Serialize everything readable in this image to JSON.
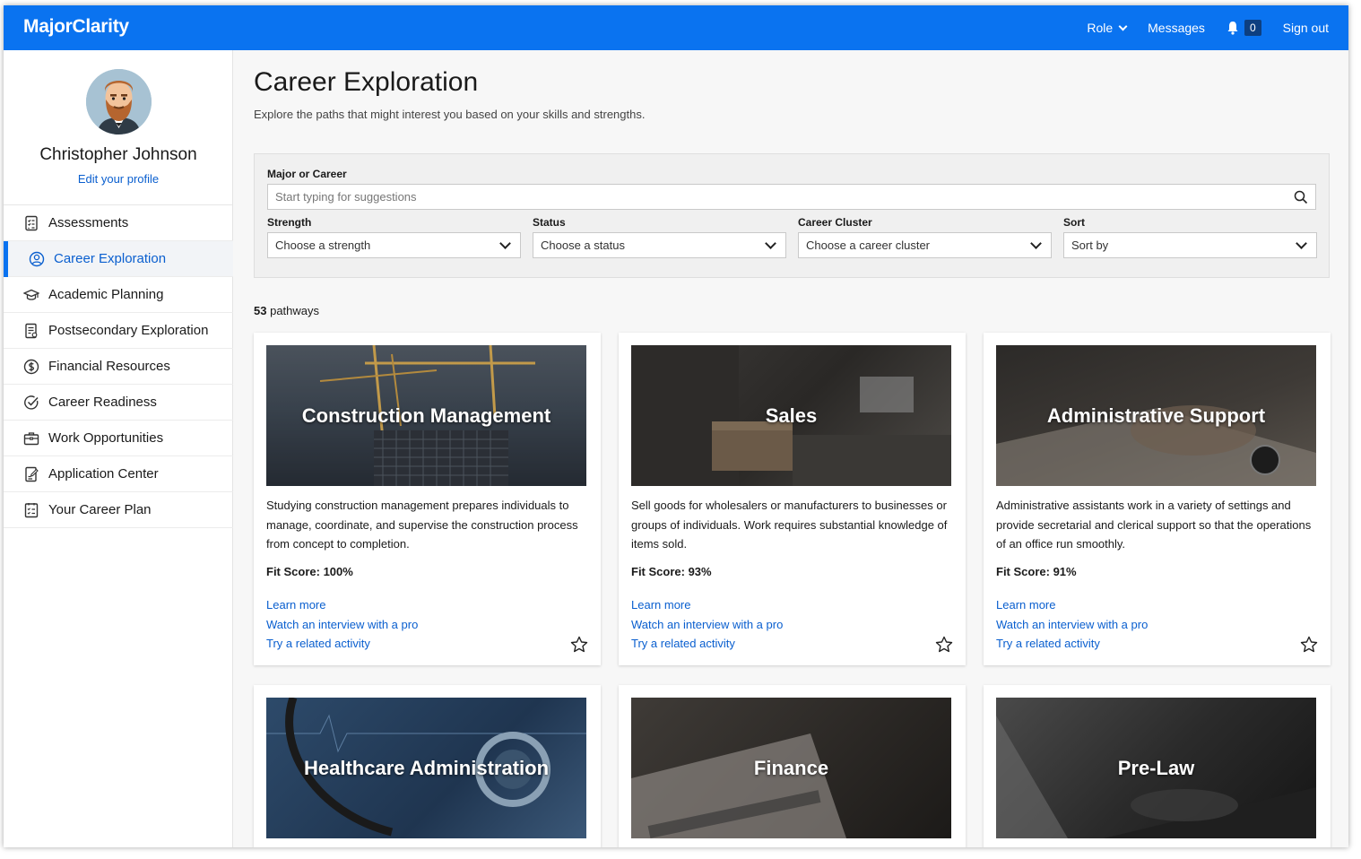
{
  "topbar": {
    "brand": "MajorClarity",
    "role_label": "Role",
    "messages_label": "Messages",
    "notification_count": "0",
    "signout_label": "Sign out",
    "color": "#0a73f0"
  },
  "sidebar": {
    "profile_name": "Christopher Johnson",
    "profile_edit": "Edit your profile",
    "items": [
      {
        "label": "Assessments",
        "icon": "checklist-icon",
        "active": false
      },
      {
        "label": "Career Exploration",
        "icon": "person-circle-icon",
        "active": true
      },
      {
        "label": "Academic Planning",
        "icon": "graduation-cap-icon",
        "active": false
      },
      {
        "label": "Postsecondary Exploration",
        "icon": "document-icon",
        "active": false
      },
      {
        "label": "Financial Resources",
        "icon": "dollar-icon",
        "active": false
      },
      {
        "label": "Career Readiness",
        "icon": "check-circle-icon",
        "active": false
      },
      {
        "label": "Work Opportunities",
        "icon": "briefcase-icon",
        "active": false
      },
      {
        "label": "Application Center",
        "icon": "application-icon",
        "active": false
      },
      {
        "label": "Your Career Plan",
        "icon": "plan-icon",
        "active": false
      }
    ]
  },
  "main": {
    "title": "Career Exploration",
    "subtitle": "Explore the paths that might interest you based on your skills and strengths.",
    "filters": {
      "search_label": "Major or Career",
      "search_placeholder": "Start typing for suggestions",
      "strength_label": "Strength",
      "strength_value": "Choose a strength",
      "status_label": "Status",
      "status_value": "Choose a status",
      "cluster_label": "Career Cluster",
      "cluster_value": "Choose a career cluster",
      "sort_label": "Sort",
      "sort_value": "Sort by"
    },
    "count_number": "53",
    "count_text": "pathways",
    "cards": [
      {
        "title": "Construction Management",
        "description": "Studying construction management prepares individuals to manage, coordinate, and supervise the construction process from concept to completion.",
        "fit": "Fit Score: 100%",
        "link1": "Learn more",
        "link2": "Watch an interview with a pro",
        "link3": "Try a related activity"
      },
      {
        "title": "Sales",
        "description": "Sell goods for wholesalers or manufacturers to businesses or groups of individuals. Work requires substantial knowledge of items sold.",
        "fit": "Fit Score: 93%",
        "link1": "Learn more",
        "link2": "Watch an interview with a pro",
        "link3": "Try a related activity"
      },
      {
        "title": "Administrative Support",
        "description": "Administrative assistants work in a variety of settings and provide secretarial and clerical support so that the operations of an office run smoothly.",
        "fit": "Fit Score: 91%",
        "link1": "Learn more",
        "link2": "Watch an interview with a pro",
        "link3": "Try a related activity"
      },
      {
        "title": "Healthcare Administration"
      },
      {
        "title": "Finance"
      },
      {
        "title": "Pre-Law"
      }
    ]
  }
}
